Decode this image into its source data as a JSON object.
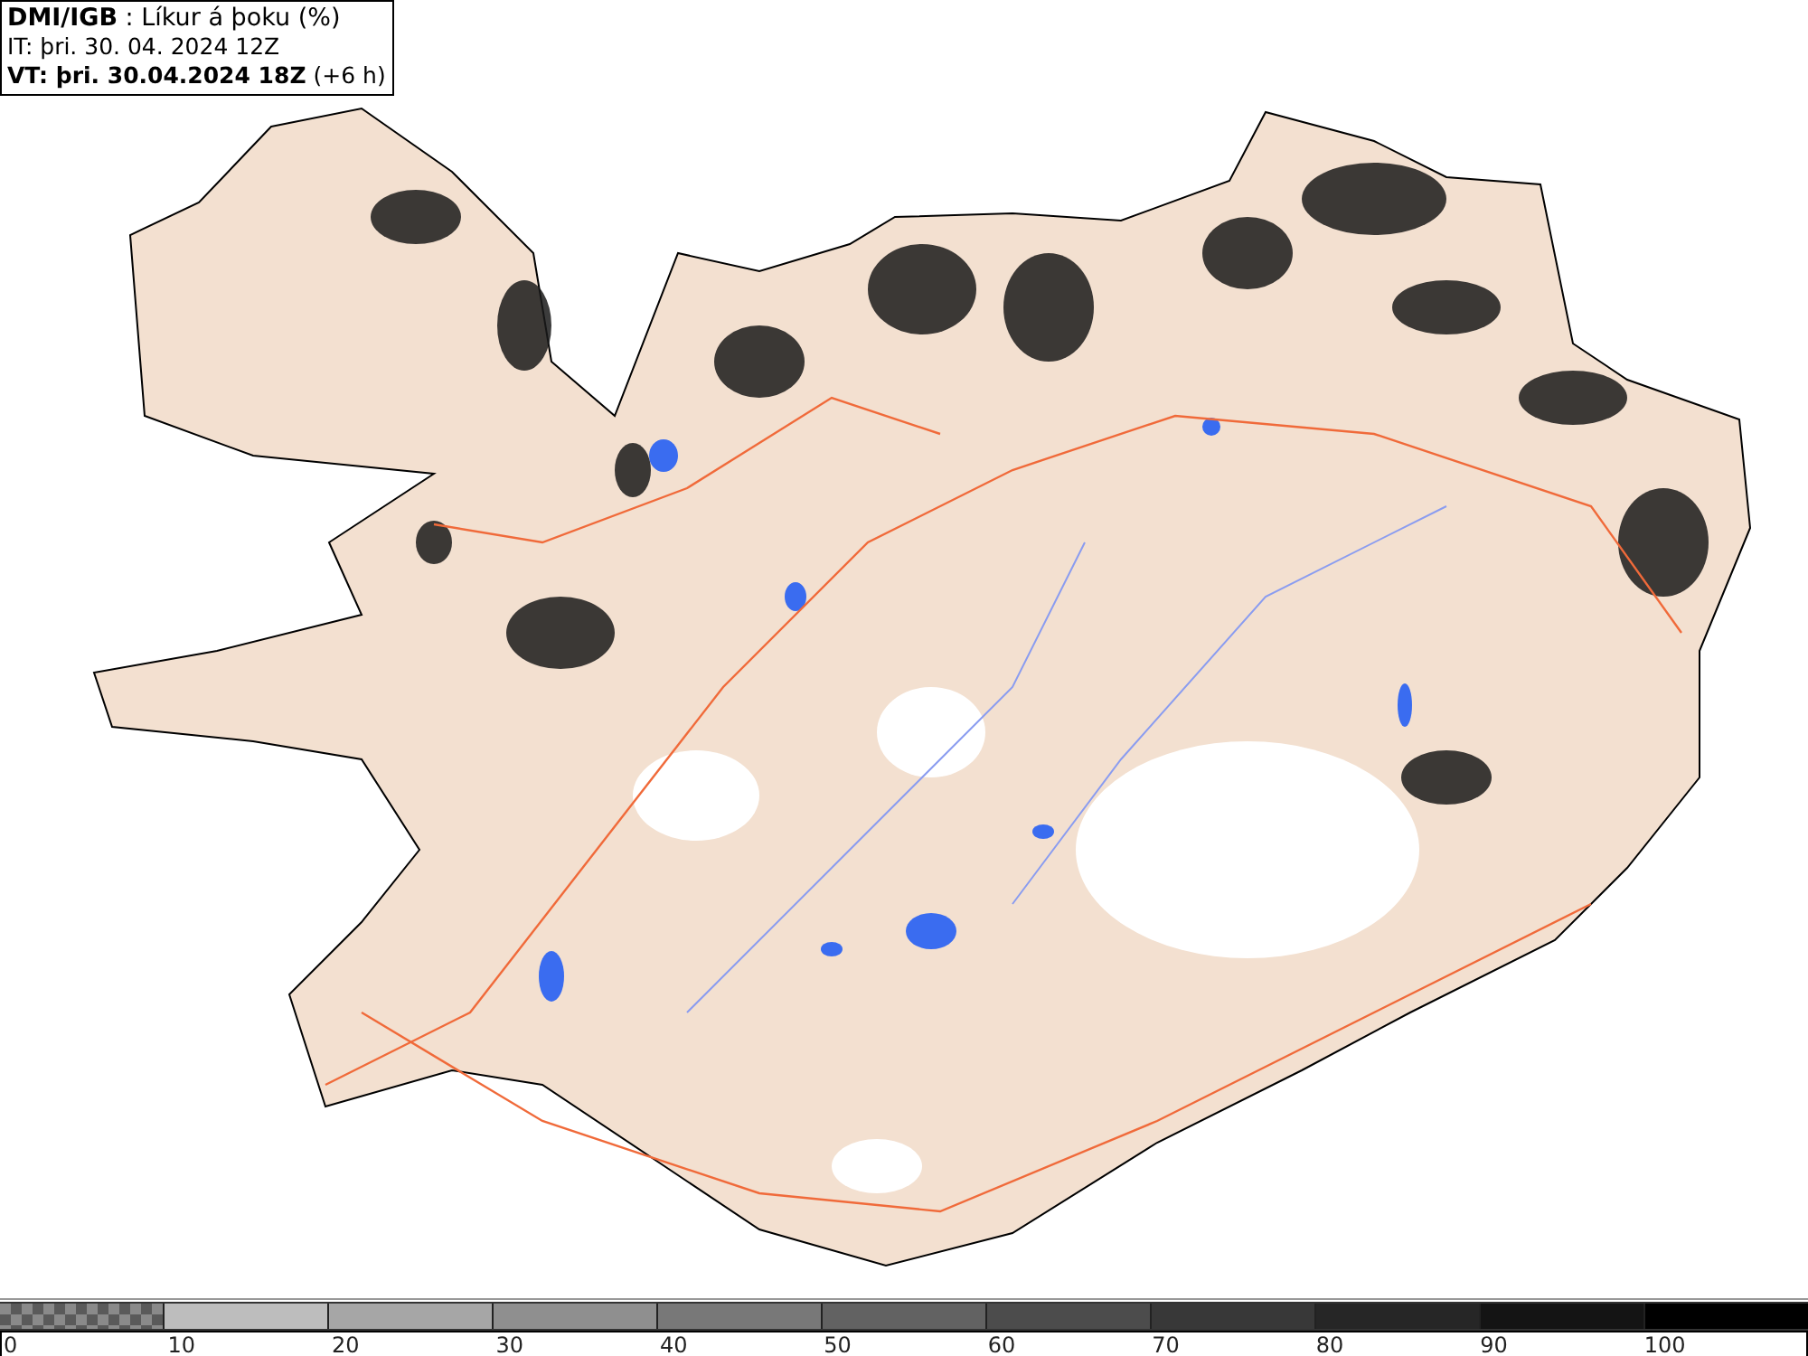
{
  "header": {
    "lines": [
      {
        "kind": "title",
        "text": "**DMI/IGB** : Líkur á þoku (%)"
      },
      {
        "kind": "plain",
        "text": "IT: þri. 30. 04. 2024 12Z"
      },
      {
        "kind": "plain",
        "text": "**VT: þri. 30.04.2024 18Z** (+6 h)"
      }
    ]
  },
  "legend": {
    "segments": [
      {
        "kind": "checker",
        "color": "#5a5a5a"
      },
      {
        "kind": "solid",
        "color": "#bdbdbd"
      },
      {
        "kind": "solid",
        "color": "#a6a6a6"
      },
      {
        "kind": "solid",
        "color": "#8f8f8f"
      },
      {
        "kind": "solid",
        "color": "#787878"
      },
      {
        "kind": "solid",
        "color": "#626262"
      },
      {
        "kind": "solid",
        "color": "#4c4c4c"
      },
      {
        "kind": "solid",
        "color": "#383838"
      },
      {
        "kind": "solid",
        "color": "#262626"
      },
      {
        "kind": "solid",
        "color": "#141414"
      },
      {
        "kind": "solid",
        "color": "#000000"
      }
    ],
    "ticks": [
      "0",
      "10",
      "20",
      "30",
      "40",
      "50",
      "60",
      "70",
      "80",
      "90",
      "100"
    ]
  }
}
